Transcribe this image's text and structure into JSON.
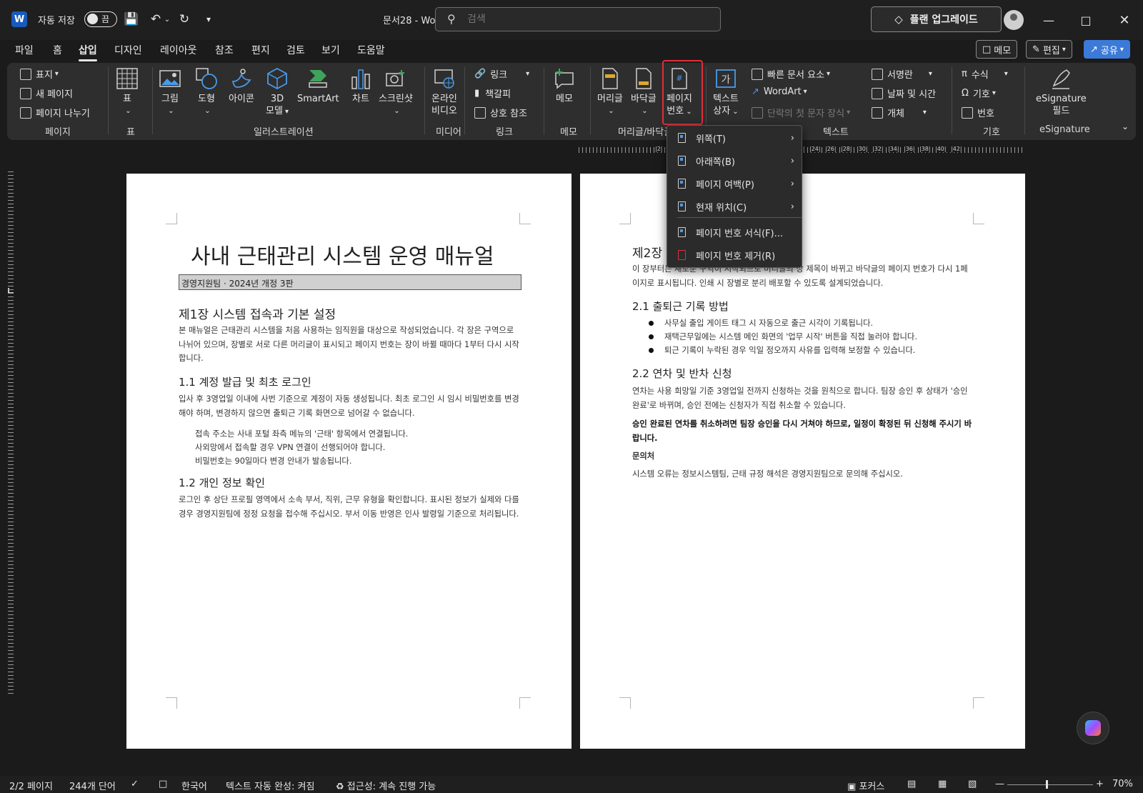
{
  "app": {
    "autosave_label": "자동 저장",
    "autosave_state": "끔",
    "doc_title": "문서28  -  Word",
    "search_placeholder": "검색",
    "upgrade_label": "플랜 업그레이드"
  },
  "tabs": [
    {
      "label": "파일"
    },
    {
      "label": "홈"
    },
    {
      "label": "삽입"
    },
    {
      "label": "디자인"
    },
    {
      "label": "레이아웃"
    },
    {
      "label": "참조"
    },
    {
      "label": "편지"
    },
    {
      "label": "검토"
    },
    {
      "label": "보기"
    },
    {
      "label": "도움말"
    }
  ],
  "tab_right": {
    "memo": "메모",
    "edit": "편집",
    "share": "공유"
  },
  "ribbon": {
    "pages": {
      "cover": "표지",
      "new_page": "새 페이지",
      "page_break": "페이지 나누기",
      "label": "페이지"
    },
    "table": {
      "btn": "표",
      "label": "표"
    },
    "illustrations": {
      "picture": "그림",
      "shapes": "도형",
      "icons": "아이콘",
      "model3d_1": "3D",
      "model3d_2": "모델",
      "smartart": "SmartArt",
      "chart": "차트",
      "screenshot": "스크린샷",
      "label": "일러스트레이션"
    },
    "media": {
      "video_1": "온라인",
      "video_2": "비디오",
      "label": "미디어"
    },
    "links": {
      "link": "링크",
      "bookmark": "책갈피",
      "cross_ref": "상호 참조",
      "label": "링크"
    },
    "comments": {
      "comment": "메모",
      "label": "메모"
    },
    "header_footer": {
      "header": "머리글",
      "footer": "바닥글",
      "page_num_1": "페이지",
      "page_num_2": "번호",
      "label": "머리글/바닥글"
    },
    "text": {
      "textbox_1": "텍스트",
      "textbox_2": "상자",
      "quick_parts": "빠른 문서 요소",
      "wordart": "WordArt",
      "dropcap": "단락의 첫 문자 장식",
      "signature": "서명란",
      "datetime": "날짜 및 시간",
      "object": "개체",
      "label": "텍스트"
    },
    "symbols": {
      "equation": "수식",
      "symbol": "기호",
      "number": "번호",
      "label": "기호"
    },
    "esig": {
      "btn_1": "eSignature",
      "btn_2": "필드",
      "label": "eSignature"
    }
  },
  "dropdown": {
    "items": [
      {
        "label": "위쪽(T)"
      },
      {
        "label": "아래쪽(B)"
      },
      {
        "label": "페이지 여백(P)"
      },
      {
        "label": "현재 위치(C)"
      },
      {
        "label": "페이지 번호 서식(F)..."
      },
      {
        "label": "페이지 번호 제거(R)"
      }
    ]
  },
  "ruler": {
    "numbers": [
      "2",
      "22",
      "24",
      "26",
      "28",
      "30",
      "32",
      "34",
      "36",
      "38",
      "40",
      "42"
    ]
  },
  "page1": {
    "title": "사내 근태관리 시스템 운영 매뉴얼",
    "subtitle": "경영지원팀 · 2024년 개정 3판",
    "h1": "제1장 시스템 접속과 기본 설정",
    "p1": "본 매뉴얼은 근태관리 시스템을 처음 사용하는 임직원을 대상으로 작성되었습니다. 각 장은 구역으로 나뉘어 있으며, 장별로 서로 다른 머리글이 표시되고 페이지 번호는 장이 바뀔 때마다 1부터 다시 시작합니다.",
    "h2_1": "1.1 계정 발급 및 최초 로그인",
    "p2": "입사 후 3영업일 이내에 사번 기준으로 계정이 자동 생성됩니다. 최초 로그인 시 임시 비밀번호를 변경해야 하며, 변경하지 않으면 출퇴근 기록 화면으로 넘어갈 수 없습니다.",
    "items": [
      "접속 주소는 사내 포털 좌측 메뉴의 '근태' 항목에서 연결됩니다.",
      "사외망에서 접속할 경우 VPN 연결이 선행되어야 합니다.",
      "비밀번호는 90일마다 변경 안내가 발송됩니다."
    ],
    "h2_2": "1.2 개인 정보 확인",
    "p3": "로그인 후 상단 프로필 영역에서 소속 부서, 직위, 근무 유형을 확인합니다. 표시된 정보가 실제와 다를 경우 경영지원팀에 정정 요청을 접수해 주십시오. 부서 이동 반영은 인사 발령일 기준으로 처리됩니다."
  },
  "page2": {
    "h1": "제2장",
    "p1": "이 장부터는 새로운 구역이 시작되므로 머리글의 장 제목이 바뀌고 바닥글의 페이지 번호가 다시 1페이지로 표시됩니다. 인쇄 시 장별로 분리 배포할 수 있도록 설계되었습니다.",
    "h2_1": "2.1 출퇴근 기록 방법",
    "bullets": [
      "사무실 출입 게이트 태그 시 자동으로 출근 시각이 기록됩니다.",
      "재택근무일에는 시스템 메인 화면의 '업무 시작' 버튼을 직접 눌러야 합니다.",
      "퇴근 기록이 누락된 경우 익일 정오까지 사유를 입력해 보정할 수 있습니다."
    ],
    "h2_2": "2.2 연차 및 반차 신청",
    "p2": "연차는 사용 희망일 기준 3영업일 전까지 신청하는 것을 원칙으로 합니다. 팀장 승인 후 상태가 '승인 완료'로 바뀌며, 승인 전에는 신청자가 직접 취소할 수 있습니다.",
    "p3": "승인 완료된 연차를 취소하려면 팀장 승인을 다시 거쳐야 하므로, 일정이 확정된 뒤 신청해 주시기 바랍니다.",
    "h3": "문의처",
    "p4": "시스템 오류는 정보시스템팀, 근태 규정 해석은 경영지원팀으로 문의해 주십시오."
  },
  "status": {
    "page": "2/2 페이지",
    "words": "244개 단어",
    "lang": "한국어",
    "autocomplete": "텍스트 자동 완성: 켜짐",
    "accessibility": "접근성: 계속 진행 가능",
    "focus": "포커스",
    "zoom": "70%"
  },
  "colors": {
    "accent": "#3c7ad8",
    "highlight": "#e0303a",
    "word_blue": "#185abd"
  }
}
